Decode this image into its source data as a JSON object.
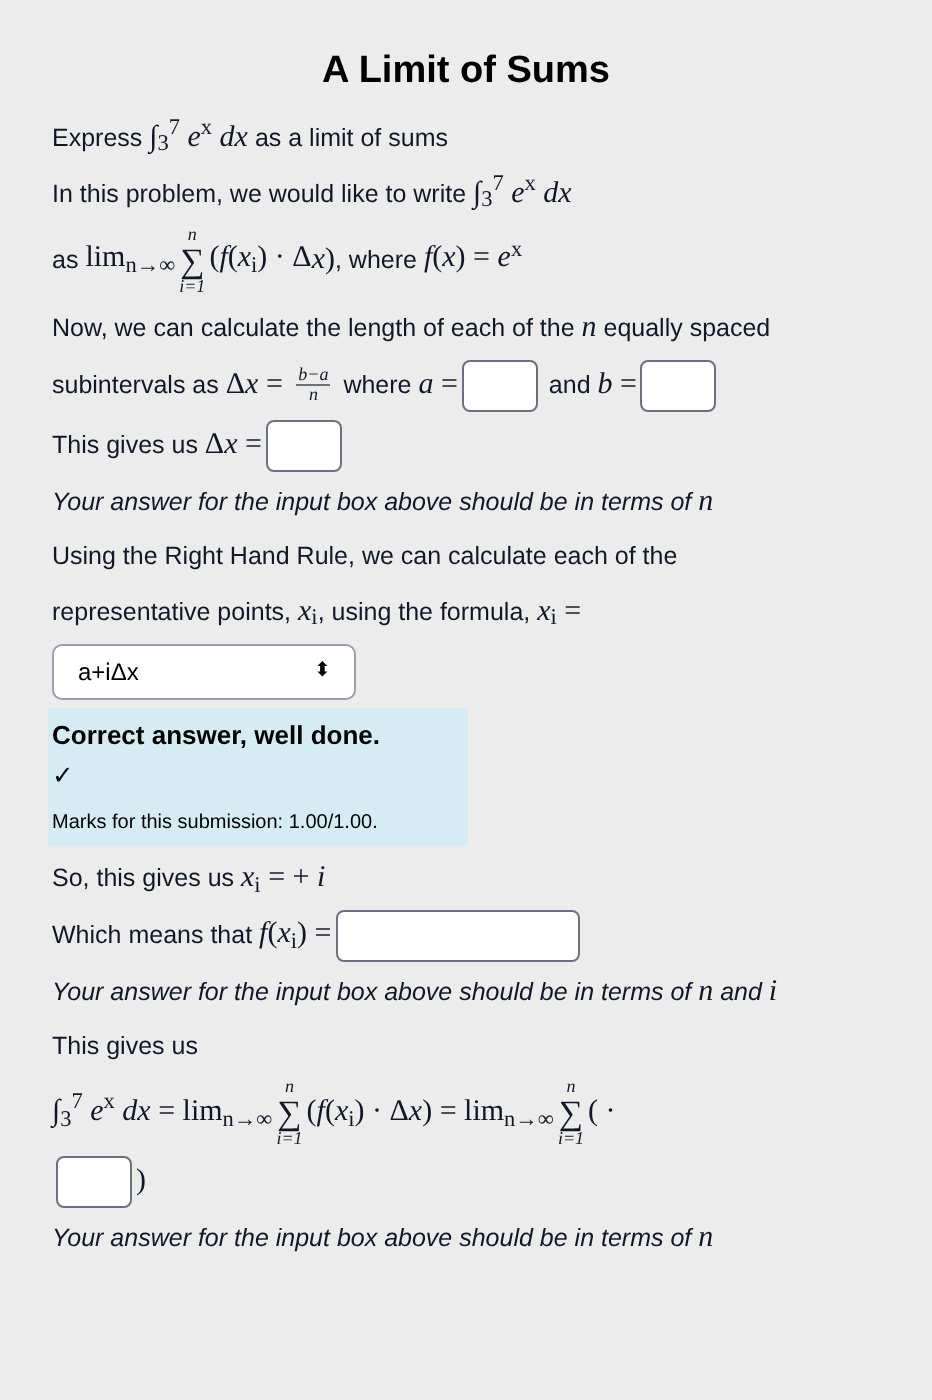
{
  "title": "A Limit of Sums",
  "blocks": [
    {
      "kind": "line",
      "segments": [
        {
          "kind": "text",
          "text": "Express "
        },
        {
          "kind": "math",
          "text": "∫$_{3}$$^{7}$ *e*$^{x}$ *dx*"
        },
        {
          "kind": "text",
          "text": " as a limit of sums"
        }
      ]
    },
    {
      "kind": "line",
      "segments": [
        {
          "kind": "text",
          "text": "In this problem, we would like to write "
        },
        {
          "kind": "math",
          "text": "∫$_{3}$$^{7}$ *e*$^{x}$ *dx*"
        }
      ]
    },
    {
      "kind": "line",
      "segments": [
        {
          "kind": "text",
          "text": "as "
        },
        {
          "kind": "math",
          "text": "lim$_{n→∞}$"
        },
        {
          "kind": "sum",
          "symbol": "∑",
          "upper": "n",
          "lower": "i=1"
        },
        {
          "kind": "math",
          "text": "(*f*(*x*$_{i}$) · Δ"
        },
        {
          "kind": "math",
          "text": "*x*)"
        },
        {
          "kind": "text",
          "text": ", where "
        },
        {
          "kind": "math",
          "text": "*f*(*x*) = *e*$^{x}$"
        }
      ]
    },
    {
      "kind": "line",
      "segments": [
        {
          "kind": "text",
          "text": "Now, we can calculate the length of each of the "
        },
        {
          "kind": "math",
          "text": "*n*"
        },
        {
          "kind": "text",
          "text": " equally spaced"
        }
      ]
    },
    {
      "kind": "line",
      "segments": [
        {
          "kind": "text",
          "text": "subintervals as "
        },
        {
          "kind": "math",
          "text": "Δ"
        },
        {
          "kind": "math",
          "text": "*x* = "
        },
        {
          "kind": "frac",
          "num": "b−a",
          "den": "n"
        },
        {
          "kind": "text",
          "text": " where "
        },
        {
          "kind": "math",
          "text": "*a* ="
        },
        {
          "kind": "input",
          "wide": false
        },
        {
          "kind": "text",
          "text": " and "
        },
        {
          "kind": "math",
          "text": "*b* ="
        },
        {
          "kind": "input",
          "wide": false
        }
      ]
    },
    {
      "kind": "line",
      "segments": [
        {
          "kind": "text",
          "text": "This gives us "
        },
        {
          "kind": "math",
          "text": "Δ"
        },
        {
          "kind": "math",
          "text": "*x* ="
        },
        {
          "kind": "input",
          "wide": false
        }
      ]
    },
    {
      "kind": "hint",
      "segments": [
        {
          "kind": "text",
          "text": "Your answer for the input box above should be in terms of "
        },
        {
          "kind": "math",
          "text": "*n*"
        }
      ]
    },
    {
      "kind": "line",
      "segments": [
        {
          "kind": "text",
          "text": "Using the Right Hand Rule, we can calculate each of the"
        }
      ]
    },
    {
      "kind": "line",
      "segments": [
        {
          "kind": "text",
          "text": "representative points, "
        },
        {
          "kind": "math",
          "text": "*x*$_{i}$"
        },
        {
          "kind": "text",
          "text": ", using the formula, "
        },
        {
          "kind": "math",
          "text": "*x*$_{i}$ ="
        }
      ]
    },
    {
      "kind": "select",
      "value": "a+iΔx",
      "arrow": "⬍"
    },
    {
      "kind": "feedback",
      "heading": "Correct answer, well done.",
      "mark": "✓",
      "marks": "Marks for this submission: 1.00/1.00."
    },
    {
      "kind": "line",
      "segments": [
        {
          "kind": "text",
          "text": "So, this gives us "
        },
        {
          "kind": "math",
          "text": "*x*$_{i}$ = + *i*"
        }
      ]
    },
    {
      "kind": "line",
      "segments": [
        {
          "kind": "text",
          "text": "Which means that "
        },
        {
          "kind": "math",
          "text": "*f*(*x*$_{i}$) ="
        },
        {
          "kind": "input",
          "wide": true
        }
      ]
    },
    {
      "kind": "hint",
      "segments": [
        {
          "kind": "text",
          "text": "Your answer for the input box above should be in terms of "
        },
        {
          "kind": "math",
          "text": "*n*"
        },
        {
          "kind": "text",
          "text": " and "
        },
        {
          "kind": "math",
          "text": "*i*"
        }
      ]
    },
    {
      "kind": "line",
      "segments": [
        {
          "kind": "text",
          "text": "This gives us"
        }
      ]
    },
    {
      "kind": "line",
      "segments": [
        {
          "kind": "math",
          "text": "∫$_{3}$$^{7}$ *e*$^{x}$ *dx* = lim$_{n→∞}$"
        },
        {
          "kind": "sum",
          "symbol": "∑",
          "upper": "n",
          "lower": "i=1"
        },
        {
          "kind": "math",
          "text": "(*f*(*x*$_{i}$) · Δ"
        },
        {
          "kind": "math",
          "text": "*x*) = lim$_{n→∞}$"
        },
        {
          "kind": "sum",
          "symbol": "∑",
          "upper": "n",
          "lower": "i=1"
        },
        {
          "kind": "math",
          "text": "( ·"
        }
      ]
    },
    {
      "kind": "line",
      "segments": [
        {
          "kind": "input",
          "wide": false
        },
        {
          "kind": "math",
          "text": ")"
        }
      ]
    },
    {
      "kind": "hint",
      "segments": [
        {
          "kind": "text",
          "text": "Your answer for the input box above should be in terms of "
        },
        {
          "kind": "math",
          "text": "*n*"
        }
      ]
    }
  ]
}
